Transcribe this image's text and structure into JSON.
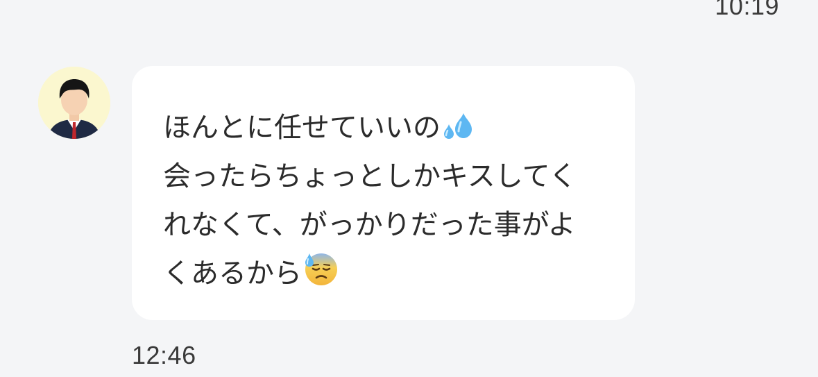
{
  "chat": {
    "previous_timestamp": "10:19",
    "message": {
      "sender_avatar_icon": "user-avatar-icon",
      "lines": [
        "ほんとに任せていいの",
        "会ったらちょっとしかキスしてく",
        "れなくて、がっかりだった事がよ",
        "くあるから"
      ],
      "emojis": {
        "line_1": "sweat-droplets-emoji",
        "line_4": "downcast-face-with-sweat-emoji"
      },
      "timestamp": "12:46"
    }
  },
  "colors": {
    "background": "#f4f5f7",
    "bubble": "#ffffff",
    "avatar_background": "#fbf7cf",
    "text": "#2b2b2b"
  }
}
